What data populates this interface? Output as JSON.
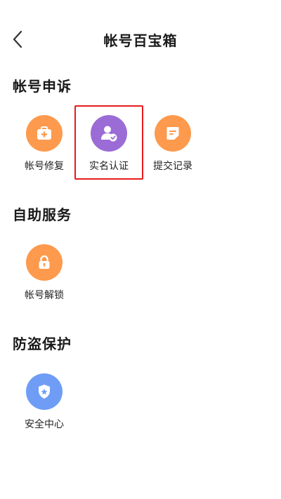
{
  "header": {
    "title": "帐号百宝箱",
    "back_icon": "chevron-left-icon"
  },
  "sections": [
    {
      "title": "帐号申诉",
      "items": [
        {
          "label": "帐号修复",
          "icon": "first-aid-kit-icon",
          "color": "#fd9a4d"
        },
        {
          "label": "实名认证",
          "icon": "user-verified-icon",
          "color": "#9b6bd6",
          "highlighted": true
        },
        {
          "label": "提交记录",
          "icon": "document-icon",
          "color": "#fd9a4d"
        }
      ]
    },
    {
      "title": "自助服务",
      "items": [
        {
          "label": "帐号解锁",
          "icon": "lock-icon",
          "color": "#fd9a4d"
        }
      ]
    },
    {
      "title": "防盗保护",
      "items": [
        {
          "label": "安全中心",
          "icon": "shield-icon",
          "color": "#6f9df6"
        }
      ]
    }
  ],
  "highlight_color": "#e81b1b"
}
